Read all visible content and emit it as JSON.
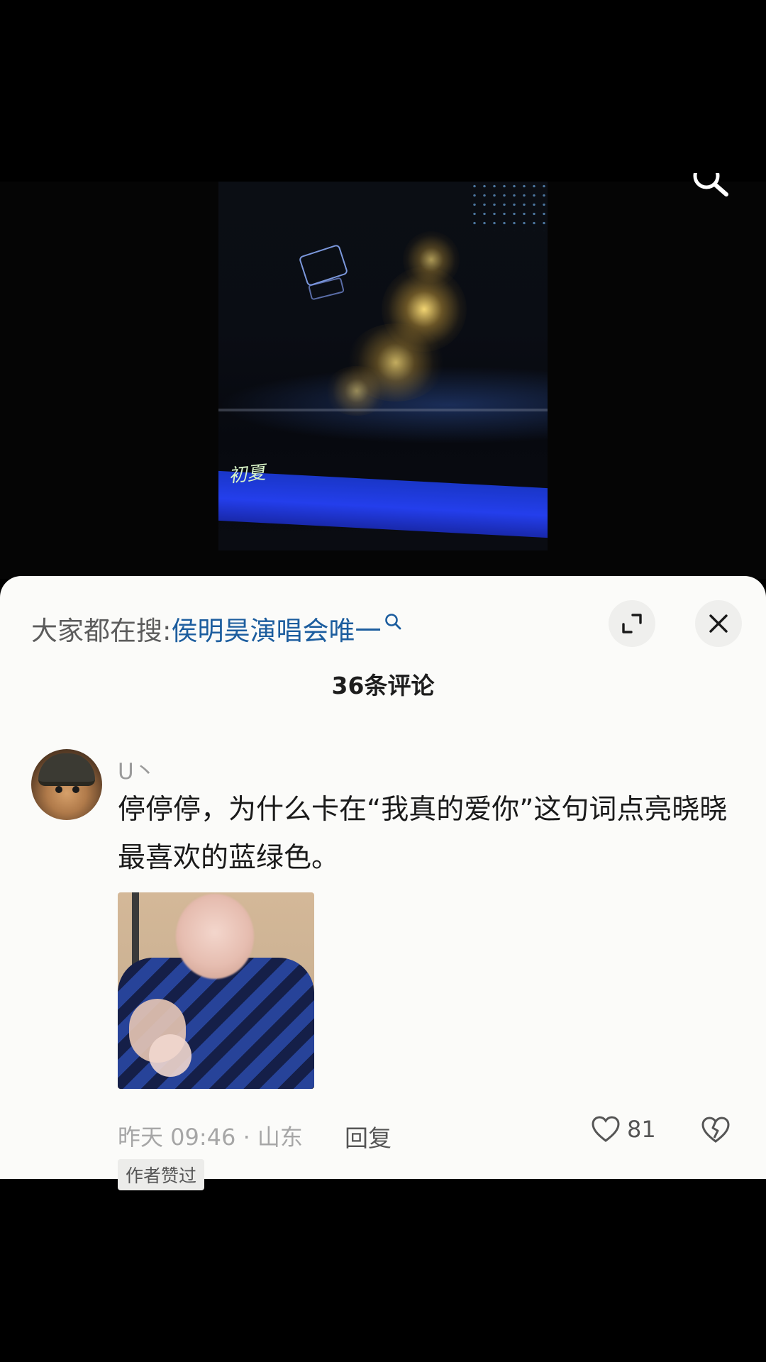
{
  "video": {
    "watermark": "初夏"
  },
  "sheet": {
    "search_prefix": "大家都在搜:",
    "search_term": "侯明昊演唱会唯一",
    "comment_count": "36条评论"
  },
  "comment": {
    "username": "U丶",
    "text": "停停停，为什么卡在“我真的爱你”这句词点亮晓晓最喜欢的蓝绿色。",
    "time_location": "昨天 09:46 · 山东",
    "reply_label": "回复",
    "like_count": "81",
    "author_badge": "作者赞过"
  },
  "icons": {
    "video_search": "search-icon",
    "search_term": "search-icon",
    "expand": "expand-icon",
    "close": "close-icon",
    "like": "heart-icon",
    "dislike": "broken-heart-icon"
  },
  "colors": {
    "search_link": "#1c5d9e",
    "sheet_background": "#fbfbf9",
    "video_strip": "#2643ff"
  }
}
